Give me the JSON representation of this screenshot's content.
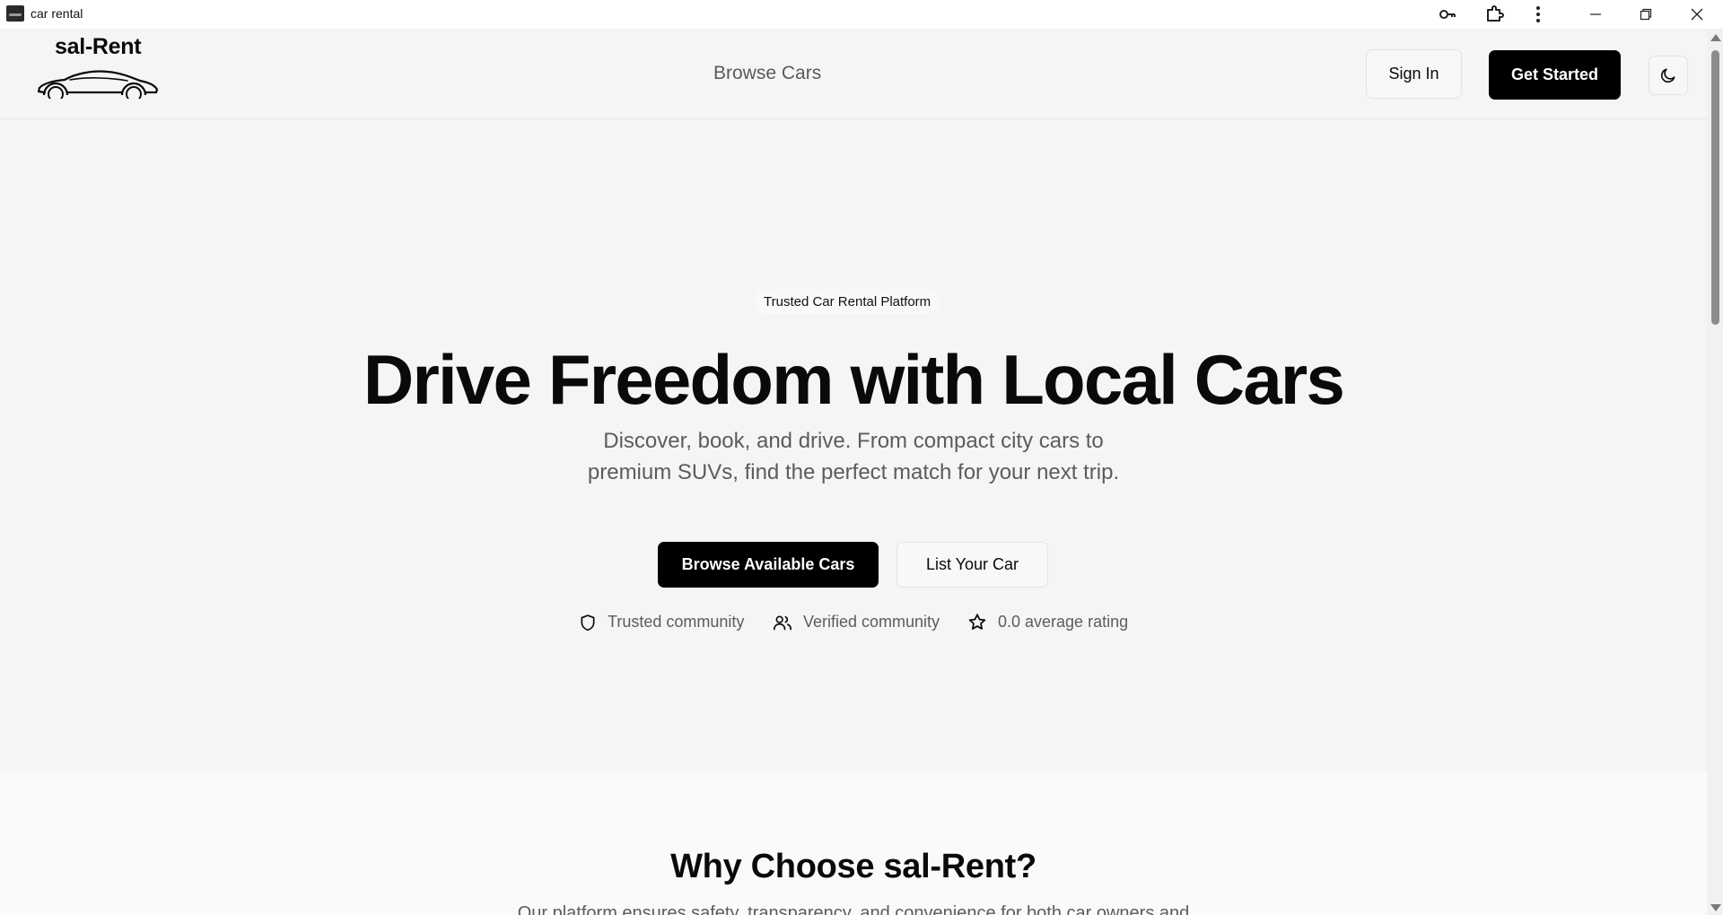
{
  "window": {
    "title": "car rental",
    "icons": [
      "key-icon",
      "extensions-icon",
      "menu-dots-icon",
      "minimize-icon",
      "restore-icon",
      "close-icon"
    ]
  },
  "navbar": {
    "brand_name": "sal-Rent",
    "links": [
      {
        "label": "Browse Cars"
      }
    ],
    "sign_in_label": "Sign In",
    "get_started_label": "Get Started",
    "theme_icon": "moon-icon"
  },
  "hero": {
    "badge": "Trusted Car Rental Platform",
    "title": "Drive Freedom with Local Cars",
    "subtitle_line1": "Discover, book, and drive. From compact city cars to",
    "subtitle_line2": "premium SUVs, find the perfect match for your next trip.",
    "primary_cta": "Browse Available Cars",
    "secondary_cta": "List Your Car",
    "stats": [
      {
        "icon": "shield-icon",
        "label": "Trusted community"
      },
      {
        "icon": "users-icon",
        "label": "Verified community"
      },
      {
        "icon": "star-icon",
        "label": "0.0 average rating"
      }
    ]
  },
  "why": {
    "title": "Why Choose sal-Rent?",
    "text": "Our platform ensures safety, transparency, and convenience for both car owners and"
  },
  "colors": {
    "accent": "#000000",
    "background": "#f5f5f5",
    "muted_text": "#5c5c5c"
  }
}
